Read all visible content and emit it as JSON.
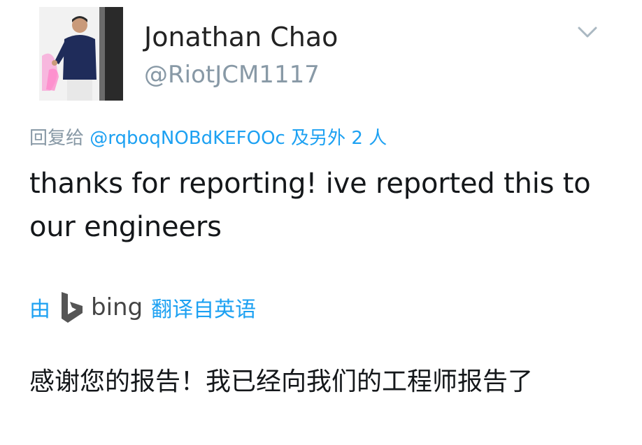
{
  "author": {
    "display_name": "Jonathan Chao",
    "handle": "@RiotJCM1117",
    "avatar_icon": "user-avatar-photo"
  },
  "menu": {
    "icon": "chevron-down-icon"
  },
  "reply": {
    "prefix": "回复给",
    "mention": "@rqboqNOBdKEFOOc",
    "others": "及另外 2 人"
  },
  "tweet": {
    "text": "thanks for reporting! ive reported this to our engineers"
  },
  "translation": {
    "by_label": "由",
    "provider_icon": "bing-logo-icon",
    "provider_name": "bing",
    "from_label": "翻译自英语",
    "text": "感谢您的报告！我已经向我们的工程师报告了"
  },
  "colors": {
    "link": "#1da1f2",
    "muted": "#8899a6",
    "text": "#14171a"
  }
}
